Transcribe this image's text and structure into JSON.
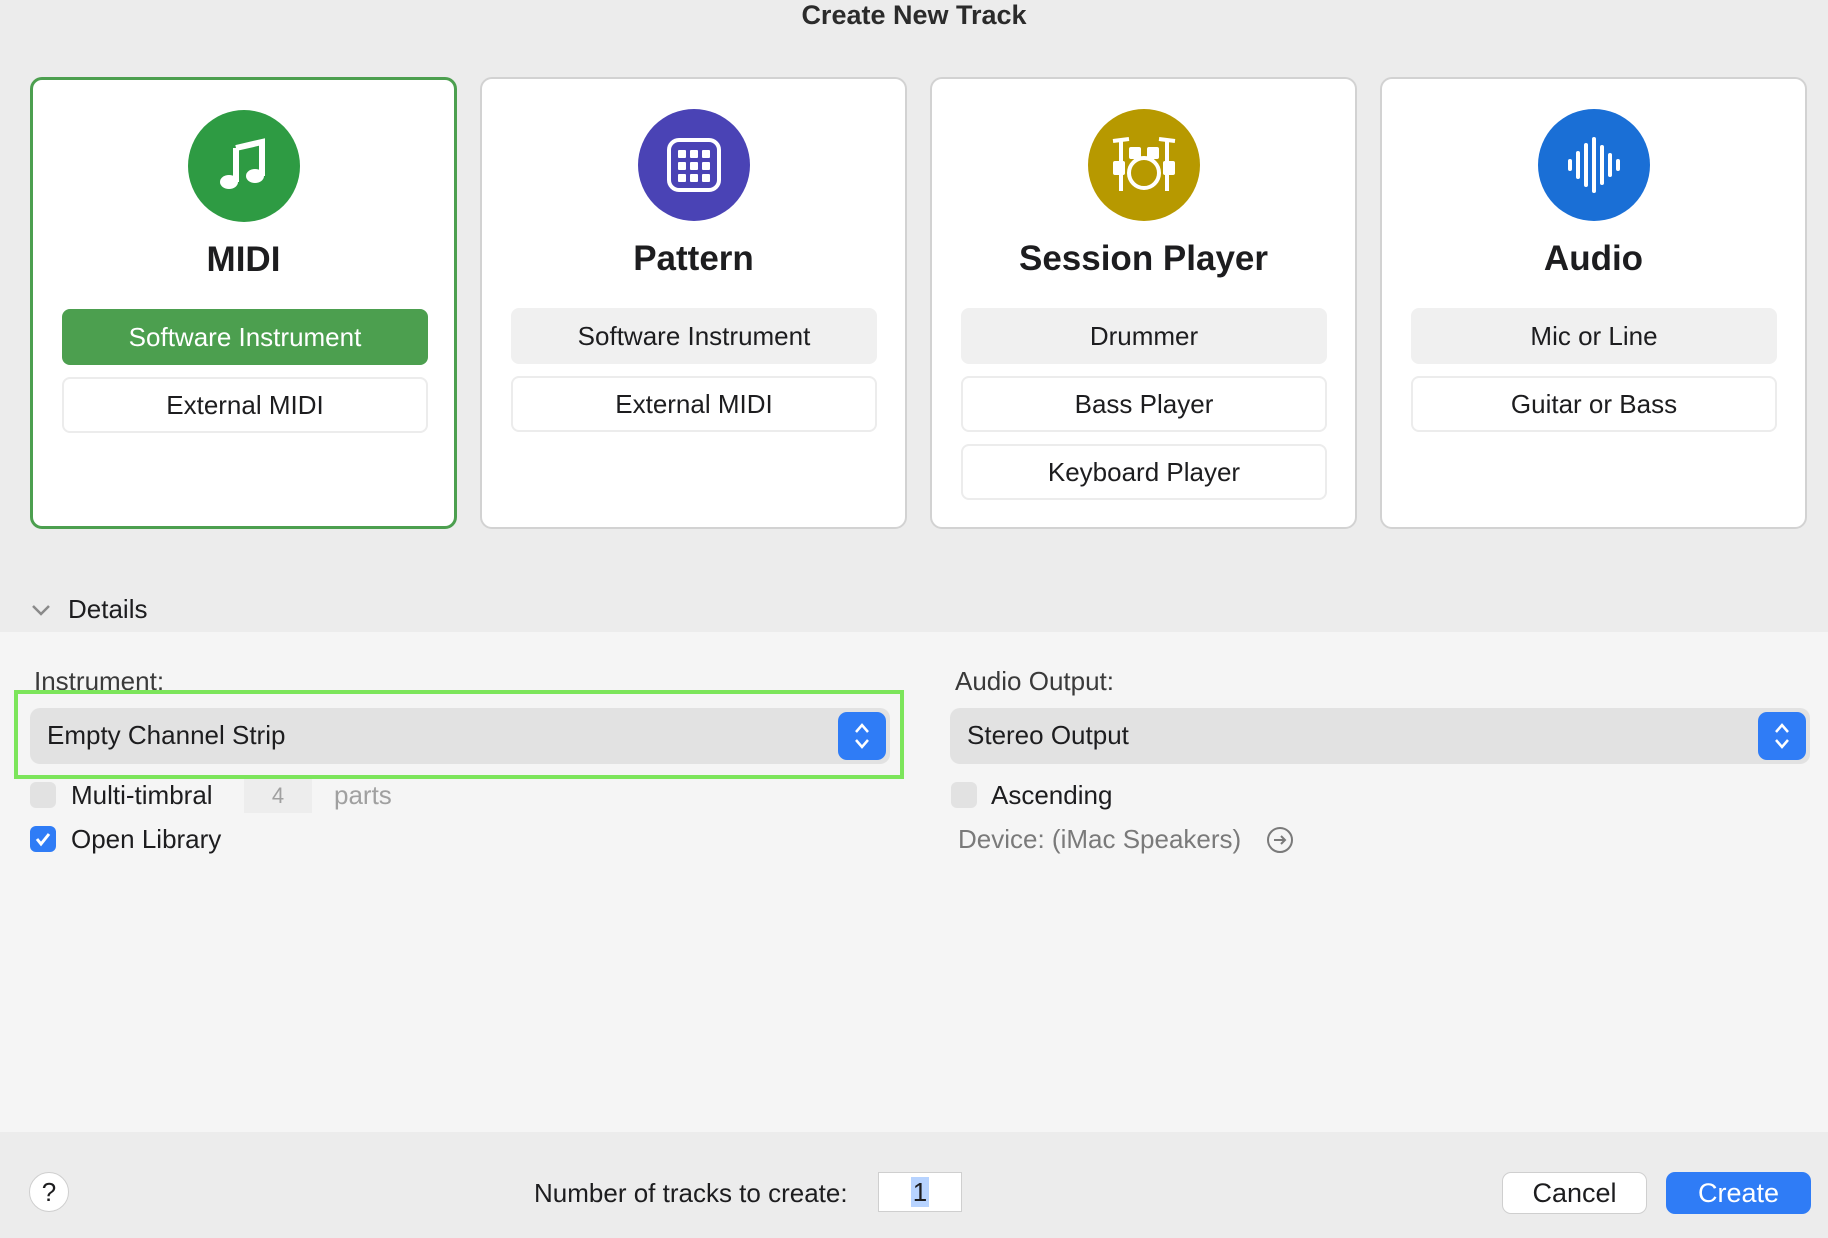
{
  "window": {
    "title": "Create New Track"
  },
  "cards": [
    {
      "title": "MIDI",
      "icon": "music-note-icon",
      "color": "#2e9b43",
      "options": [
        "Software Instrument",
        "External MIDI"
      ]
    },
    {
      "title": "Pattern",
      "icon": "pattern-grid-icon",
      "color": "#4a43b5",
      "options": [
        "Software Instrument",
        "External MIDI"
      ]
    },
    {
      "title": "Session Player",
      "icon": "drum-kit-icon",
      "color": "#b79900",
      "options": [
        "Drummer",
        "Bass Player",
        "Keyboard Player"
      ]
    },
    {
      "title": "Audio",
      "icon": "waveform-icon",
      "color": "#1a6fd6",
      "options": [
        "Mic or Line",
        "Guitar or Bass"
      ]
    }
  ],
  "details": {
    "toggle_label": "Details",
    "instrument_label": "Instrument:",
    "instrument_value": "Empty Channel Strip",
    "multitimbral_label": "Multi-timbral",
    "multitimbral_parts": "4",
    "parts_label": "parts",
    "open_library_label": "Open Library",
    "audio_output_label": "Audio Output:",
    "audio_output_value": "Stereo Output",
    "ascending_label": "Ascending",
    "device_label": "Device: (iMac Speakers)"
  },
  "footer": {
    "help_label": "?",
    "count_label": "Number of tracks to create:",
    "count_value": "1",
    "cancel_label": "Cancel",
    "create_label": "Create"
  },
  "colors": {
    "accent": "#2f7cf6",
    "selected_green": "#4c9f4f",
    "highlight": "#7ce55b"
  }
}
